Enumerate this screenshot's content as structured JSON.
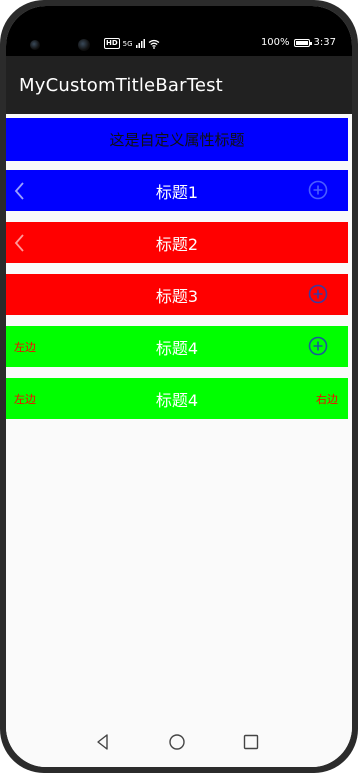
{
  "status_bar": {
    "network_badge": "HD",
    "signal_text": "5G",
    "battery_percent": "100%",
    "time": "3:37"
  },
  "app_bar": {
    "title": "MyCustomTitleBarTest"
  },
  "header": {
    "text": "这是自定义属性标题",
    "background": "#0000ff"
  },
  "title_bars": [
    {
      "title": "标题1",
      "background": "#0000ff",
      "left_icon": "back-arrow-icon",
      "right_icon": "plus-circle-icon"
    },
    {
      "title": "标题2",
      "background": "#ff0000",
      "left_icon": "back-arrow-icon"
    },
    {
      "title": "标题3",
      "background": "#ff0000",
      "right_icon": "plus-circle-icon"
    },
    {
      "title": "标题4",
      "background": "#00ff00",
      "left_text": "左边",
      "right_icon": "plus-circle-icon"
    },
    {
      "title": "标题4",
      "background": "#00ff00",
      "left_text": "左边",
      "right_text": "右边"
    }
  ],
  "colors": {
    "side_text": "#ff0000",
    "title_text": "#ffffff",
    "app_bar": "#212121"
  },
  "nav_bar": {
    "buttons": [
      "back-triangle-icon",
      "home-circle-icon",
      "recents-square-icon"
    ]
  }
}
